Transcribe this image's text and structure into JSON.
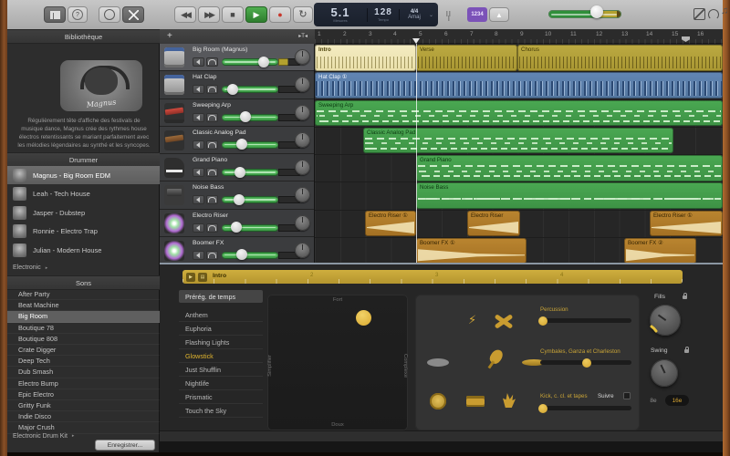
{
  "toolbar": {
    "help_label": "?",
    "count_in": "1234",
    "lcd": {
      "position": "5.1",
      "position_label": "Mesures",
      "tempo": "128",
      "tempo_label": "Tempo",
      "signature": "4/4",
      "key": "Amaj"
    }
  },
  "sidebar": {
    "title": "Bibliothèque",
    "avatar_signature": "Magnus",
    "description": "Régulièrement tête d'affiche des festivals de musique dance, Magnus crée des rythmes house électros retentissants se mariant parfaitement avec les mélodies légendaires au synthé et les syncopes.",
    "drummer_header": "Drummer",
    "drummers": [
      "Magnus - Big Room EDM",
      "Leah - Tech House",
      "Jasper - Dubstep",
      "Ronnie - Electro Trap",
      "Julian - Modern House"
    ],
    "electronic_category": "Electronic",
    "sounds_header": "Sons",
    "sounds": [
      "After Party",
      "Beat Machine",
      "Big Room",
      "Boutique 78",
      "Boutique 808",
      "Crate Digger",
      "Deep Tech",
      "Dub Smash",
      "Electro Bump",
      "Epic Electro",
      "Gritty Funk",
      "Indie Disco",
      "Major Crush"
    ],
    "kit_category": "Electronic Drum Kit",
    "save_button": "Enregistrer..."
  },
  "track_header": {
    "add_label": "+",
    "zoom_label": "▸T◂"
  },
  "tracks": [
    "Big Room (Magnus)",
    "Hat Clap",
    "Sweeping Arp",
    "Classic Analog Pad",
    "Grand Piano",
    "Noise Bass",
    "Electro Riser",
    "Boomer FX"
  ],
  "ruler": [
    "1",
    "2",
    "3",
    "4",
    "5",
    "6",
    "7",
    "8",
    "9",
    "10",
    "11",
    "12",
    "13",
    "14",
    "15",
    "16"
  ],
  "regions": {
    "intro": "Intro",
    "verse": "Verse",
    "chorus": "Chorus",
    "hat_clap": "Hat Clap ①",
    "sweeping_arp": "Sweeping Arp",
    "classic_pad": "Classic Analog Pad",
    "grand_piano": "Grand Piano",
    "noise_bass": "Noise Bass",
    "electro_riser_1": "Electro Riser ①",
    "electro_riser_2": "Electro Riser",
    "electro_riser_3": "Electro Riser ①",
    "boomer_fx_1": "Boomer FX ①",
    "boomer_fx_2": "Boomer FX ②"
  },
  "editor": {
    "region_title": "Intro",
    "beat_labels": [
      "2",
      "3",
      "4"
    ],
    "presets_header": "Prérég. de temps",
    "presets": [
      "Anthem",
      "Euphoria",
      "Flashing Lights",
      "Glowstick",
      "Just Shufflin",
      "Nightlife",
      "Prismatic",
      "Touch the Sky"
    ],
    "xy": {
      "top": "Fort",
      "bottom": "Doux",
      "left": "Simplifier",
      "right": "Complexe"
    },
    "rows": [
      {
        "label": "Percussion"
      },
      {
        "label": "Cymbales, Ganza et Charleston"
      },
      {
        "label": "Kick, c. cl. et tapes",
        "follow_label": "Suivre"
      }
    ],
    "fills_label": "Fills",
    "swing_label": "Swing",
    "eighth": "8e",
    "sixteenth": "16e"
  },
  "colors": {
    "accent_yellow": "#d9a632",
    "region_olive": "#b3a03a",
    "region_blue": "#5b7fae",
    "region_green": "#44a04c",
    "region_orange": "#b57f2a",
    "play_green": "#3c9a3c",
    "record_red": "#d23b2f",
    "count_in_purple": "#7b52b8"
  }
}
